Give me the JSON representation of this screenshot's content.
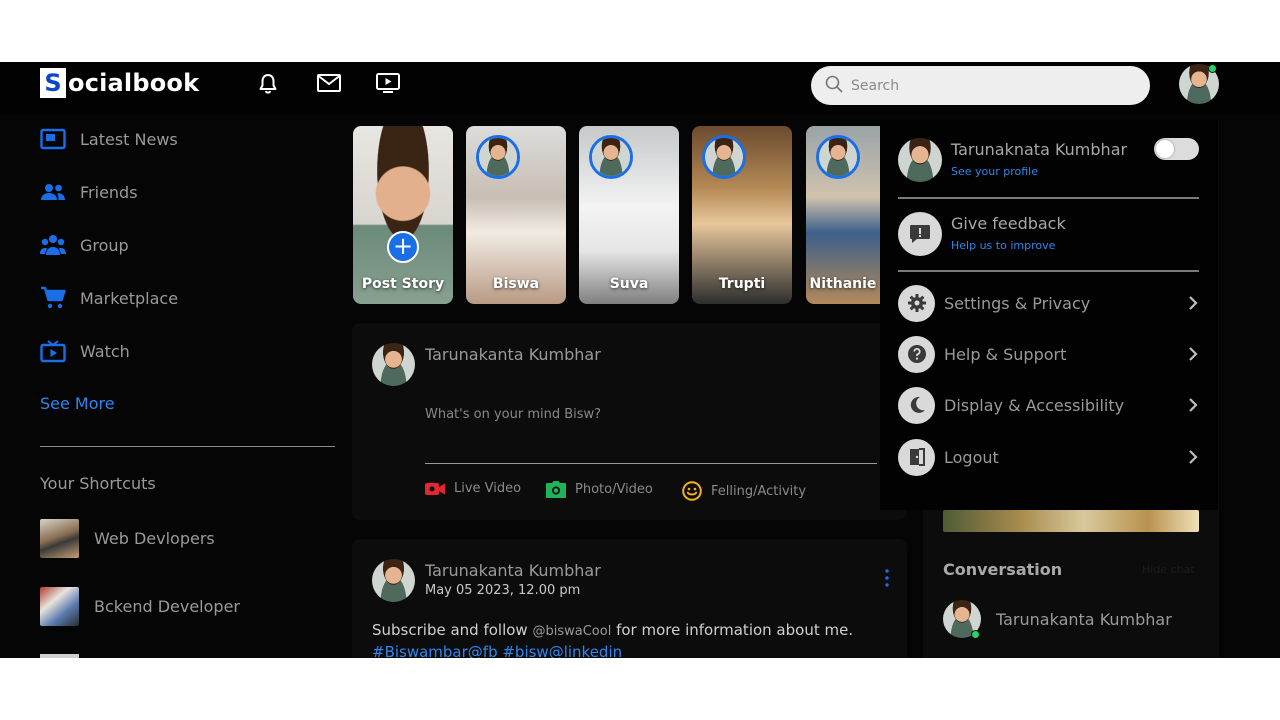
{
  "brand": {
    "logo_letter": "S",
    "logo_rest": "ocialbook",
    "accent": "#1a6fe8"
  },
  "topbar": {
    "icons": [
      "bell-icon",
      "mail-icon",
      "video-icon"
    ],
    "search_placeholder": "Search"
  },
  "sidebar": {
    "items": [
      {
        "label": "Latest News",
        "icon": "news-icon"
      },
      {
        "label": "Friends",
        "icon": "friends-icon"
      },
      {
        "label": "Group",
        "icon": "group-icon"
      },
      {
        "label": "Marketplace",
        "icon": "cart-icon"
      },
      {
        "label": "Watch",
        "icon": "tv-icon"
      }
    ],
    "see_more": "See More",
    "shortcuts_title": "Your Shortcuts",
    "shortcuts": [
      {
        "label": "Web Devlopers"
      },
      {
        "label": "Bckend Developer"
      }
    ]
  },
  "stories": [
    {
      "name": "Post Story"
    },
    {
      "name": "Biswa"
    },
    {
      "name": "Suva"
    },
    {
      "name": "Trupti"
    },
    {
      "name": "Nithanie"
    }
  ],
  "composer": {
    "author": "Tarunakanta Kumbhar",
    "placeholder": "What's on your mind Bisw?",
    "actions": [
      {
        "label": "Live Video",
        "icon": "live-video-icon"
      },
      {
        "label": "Photo/Video",
        "icon": "camera-icon"
      },
      {
        "label": "Felling/Activity",
        "icon": "smile-icon"
      }
    ]
  },
  "post": {
    "author": "Tarunakanta Kumbhar",
    "date": "May 05 2023, 12.00 pm",
    "text_before": "Subscribe and follow ",
    "mention": "@biswaCool",
    "text_after": " for more information about me.",
    "tags": "#Biswambar@fb #bisw@linkedin"
  },
  "dropdown": {
    "profile_name": "Tarunaknata Kumbhar",
    "profile_sub": "See your profile",
    "feedback_title": "Give feedback",
    "feedback_sub": "Help us to improve",
    "items": [
      {
        "label": "Settings & Privacy",
        "icon": "gear-icon"
      },
      {
        "label": "Help & Support",
        "icon": "help-icon"
      },
      {
        "label": "Display & Accessibility",
        "icon": "moon-icon"
      },
      {
        "label": "Logout",
        "icon": "logout-icon"
      }
    ]
  },
  "conversation": {
    "title": "Conversation",
    "hide_chat": "Hide chat",
    "contact": "Tarunakanta Kumbhar"
  }
}
